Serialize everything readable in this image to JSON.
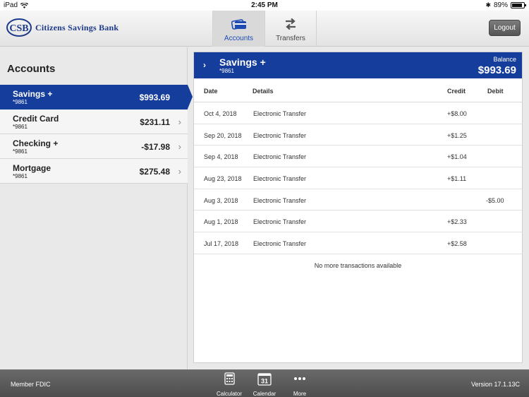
{
  "status_bar": {
    "carrier": "iPad",
    "time": "2:45 PM",
    "battery": "89%",
    "battery_level": 0.89
  },
  "header": {
    "brand": "Citizens Savings Bank",
    "brand_initials": "CSB",
    "tabs": [
      {
        "label": "Accounts",
        "icon": "credit-card-icon",
        "active": true
      },
      {
        "label": "Transfers",
        "icon": "transfer-arrows-icon",
        "active": false
      }
    ],
    "logout_label": "Logout"
  },
  "sidebar": {
    "title": "Accounts",
    "accounts": [
      {
        "name": "Savings +",
        "number": "*9861",
        "balance": "$993.69",
        "active": true
      },
      {
        "name": "Credit Card",
        "number": "*9861",
        "balance": "$231.11",
        "active": false
      },
      {
        "name": "Checking +",
        "number": "*9861",
        "balance": "-$17.98",
        "active": false
      },
      {
        "name": "Mortgage",
        "number": "*9861",
        "balance": "$275.48",
        "active": false
      }
    ]
  },
  "detail": {
    "account_name": "Savings +",
    "account_number": "*9861",
    "balance_label": "Balance",
    "balance": "$993.69",
    "columns": {
      "date": "Date",
      "details": "Details",
      "credit": "Credit",
      "debit": "Debit"
    },
    "transactions": [
      {
        "date": "Oct 4, 2018",
        "details": "Electronic Transfer",
        "credit": "+$8.00",
        "debit": ""
      },
      {
        "date": "Sep 20, 2018",
        "details": "Electronic Transfer",
        "credit": "+$1.25",
        "debit": ""
      },
      {
        "date": "Sep 4, 2018",
        "details": "Electronic Transfer",
        "credit": "+$1.04",
        "debit": ""
      },
      {
        "date": "Aug 23, 2018",
        "details": "Electronic Transfer",
        "credit": "+$1.11",
        "debit": ""
      },
      {
        "date": "Aug 3, 2018",
        "details": "Electronic Transfer",
        "credit": "",
        "debit": "-$5.00"
      },
      {
        "date": "Aug 1, 2018",
        "details": "Electronic Transfer",
        "credit": "+$2.33",
        "debit": ""
      },
      {
        "date": "Jul 17, 2018",
        "details": "Electronic Transfer",
        "credit": "+$2.58",
        "debit": ""
      }
    ],
    "no_more": "No more transactions available"
  },
  "footer": {
    "member": "Member FDIC",
    "tools": [
      {
        "label": "Calculator",
        "icon": "calculator-icon"
      },
      {
        "label": "Calendar",
        "icon": "calendar-icon",
        "day": "31"
      },
      {
        "label": "More",
        "icon": "more-dots-icon"
      }
    ],
    "version": "Version 17.1.13C"
  },
  "colors": {
    "brand_blue": "#153d9c",
    "logo_blue": "#1d3a8a",
    "footer_gray": "#5a5a5a"
  }
}
